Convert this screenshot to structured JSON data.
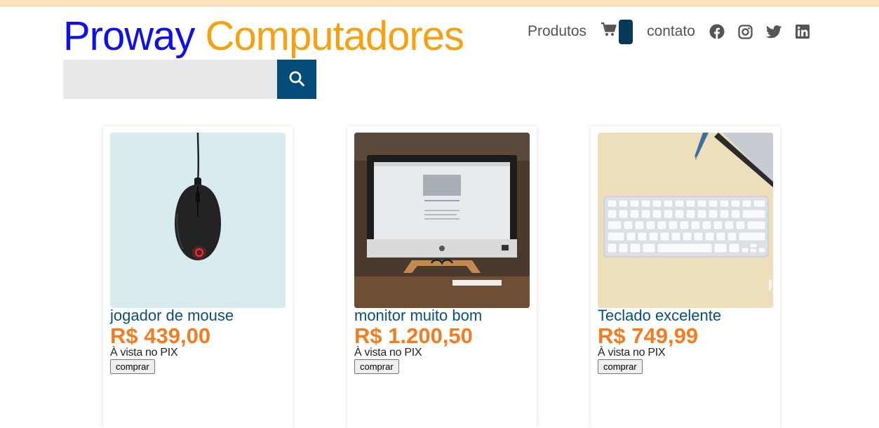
{
  "header": {
    "brand_part1": "Proway",
    "brand_part2": "Computadores",
    "brand_color1": "#1010e6",
    "brand_color2": "#f6a10f",
    "nav": {
      "produtos": "Produtos",
      "contato": "contato",
      "cart_icon": "shopping-cart-icon",
      "cart_count": "",
      "social_icons": [
        "facebook-icon",
        "instagram-icon",
        "twitter-icon",
        "linkedin-icon"
      ]
    }
  },
  "search": {
    "placeholder": "",
    "value": "",
    "button_icon": "search-icon",
    "button_color": "#044d7a"
  },
  "products": [
    {
      "title": "jogador de mouse",
      "price": "R$ 439,00",
      "payment_note": "À vista no PIX",
      "buy_label": "comprar"
    },
    {
      "title": "monitor muito bom",
      "price": "R$ 1.200,50",
      "payment_note": "À vista no PIX",
      "buy_label": "comprar"
    },
    {
      "title": "Teclado excelente",
      "price": "R$ 749,99",
      "payment_note": "À vista no PIX",
      "buy_label": "comprar"
    }
  ],
  "colors": {
    "title_blue": "#0a4e7a",
    "price_orange": "#f47c20",
    "top_bar": "#fde2bd"
  }
}
